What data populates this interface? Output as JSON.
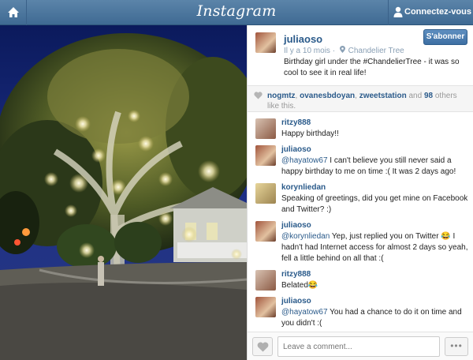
{
  "header": {
    "logo": "Instagram",
    "connect_label": "Connectez-vous"
  },
  "post": {
    "owner": "juliaoso",
    "time_ago": "Il y a 10 mois",
    "location": "Chandelier Tree",
    "caption": "Birthday girl under the #ChandelierTree - it was so cool to see it in real life!",
    "follow_label": "S'abonner"
  },
  "likes": {
    "users": [
      "nogmtz",
      "ovanesbdoyan",
      "zweetstation"
    ],
    "sep1": ", ",
    "sep2": ", ",
    "and_text": " and ",
    "count": "98",
    "others_text": " others like this."
  },
  "comments": [
    {
      "user": "ritzy888",
      "mention": "",
      "text": "Happy birthday!!"
    },
    {
      "user": "juliaoso",
      "mention": "@hayatow67",
      "text": " I can't believe you still never said a happy birthday to me on time :( It was 2 days ago!"
    },
    {
      "user": "korynliedan",
      "mention": "",
      "text": "Speaking of greetings, did you get mine on Facebook and Twitter? :)"
    },
    {
      "user": "juliaoso",
      "mention": "@korynliedan",
      "text": " Yep, just replied you on Twitter 😂 I hadn't had Internet access for almost 2 days so yeah, fell a little behind on all that :("
    },
    {
      "user": "ritzy888",
      "mention": "",
      "text": "Belated😂"
    },
    {
      "user": "juliaoso",
      "mention": "@hayatow67",
      "text": " You had a chance to do it on time and you didn't :("
    }
  ],
  "footer": {
    "comment_placeholder": "Leave a comment...",
    "more_label": "•••"
  },
  "colors": {
    "header_bar": "#4a77a0",
    "link_blue": "#2a5a8a",
    "follow_button": "#4a7db2"
  },
  "icons": [
    "home-icon",
    "user-icon",
    "location-pin-icon",
    "heart-icon"
  ]
}
